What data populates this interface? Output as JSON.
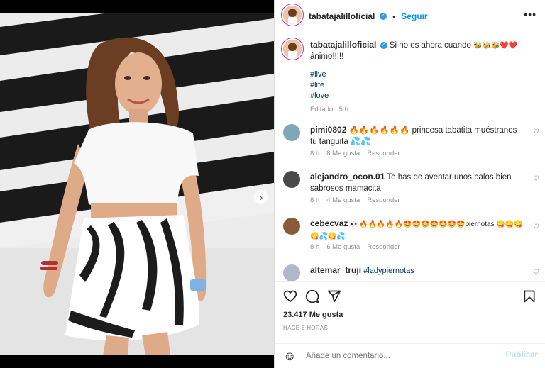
{
  "post": {
    "username": "tabatajalilloficial",
    "follow_label": "Seguir",
    "separator": "•",
    "verified_glyph": "✓",
    "more_glyph": "•••"
  },
  "caption": {
    "username": "tabatajalilloficial",
    "text": "Si no es ahora cuando",
    "emojis": "🐝🐝🐝❤️❤️",
    "text2": "ánimo!!!!!",
    "hashtags": [
      "#live",
      "#life",
      "#love"
    ],
    "edited": "Editado · 5 h"
  },
  "comments": [
    {
      "username": "pimi0802",
      "text": "🔥🔥🔥🔥🔥🔥 princesa tabatita muéstranos tu tanguita 💦💦",
      "time": "8 h",
      "likes": "8 Me gusta",
      "reply": "Responder"
    },
    {
      "username": "alejandro_ocon.01",
      "text": "Te has de aventar unos palos bien sabrosos mamacita",
      "time": "8 h",
      "likes": "4 Me gusta",
      "reply": "Responder"
    },
    {
      "username": "cebecvaz",
      "text": "👀🔥🔥🔥🔥🔥🤩🤩🤩🤩🤩🤩🤩piernotas 😋😋😋😋💦😋💦",
      "time": "8 h",
      "likes": "6 Me gusta",
      "reply": "Responder"
    },
    {
      "username": "altemar_truji",
      "text": "#ladypiernotas",
      "time": "",
      "likes": "",
      "reply": ""
    }
  ],
  "actions": {
    "likes_count": "23.417 Me gusta",
    "time_ago": "HACE 8 HORAS"
  },
  "composer": {
    "emoji_glyph": "☺",
    "placeholder": "Añade un comentario...",
    "publish_label": "Publicar"
  },
  "carousel": {
    "next_glyph": "›",
    "slides_total": 3,
    "current_index": 0
  },
  "icons": {
    "like": "heart-icon",
    "comment": "comment-bubble-icon",
    "share": "paper-plane-icon",
    "save": "bookmark-icon",
    "emoji": "smiley-icon",
    "more": "more-options-icon"
  },
  "colors": {
    "accent": "#0095f6",
    "verified": "#3897f0",
    "hashtag": "#00376b",
    "muted": "#8e8e8e"
  }
}
